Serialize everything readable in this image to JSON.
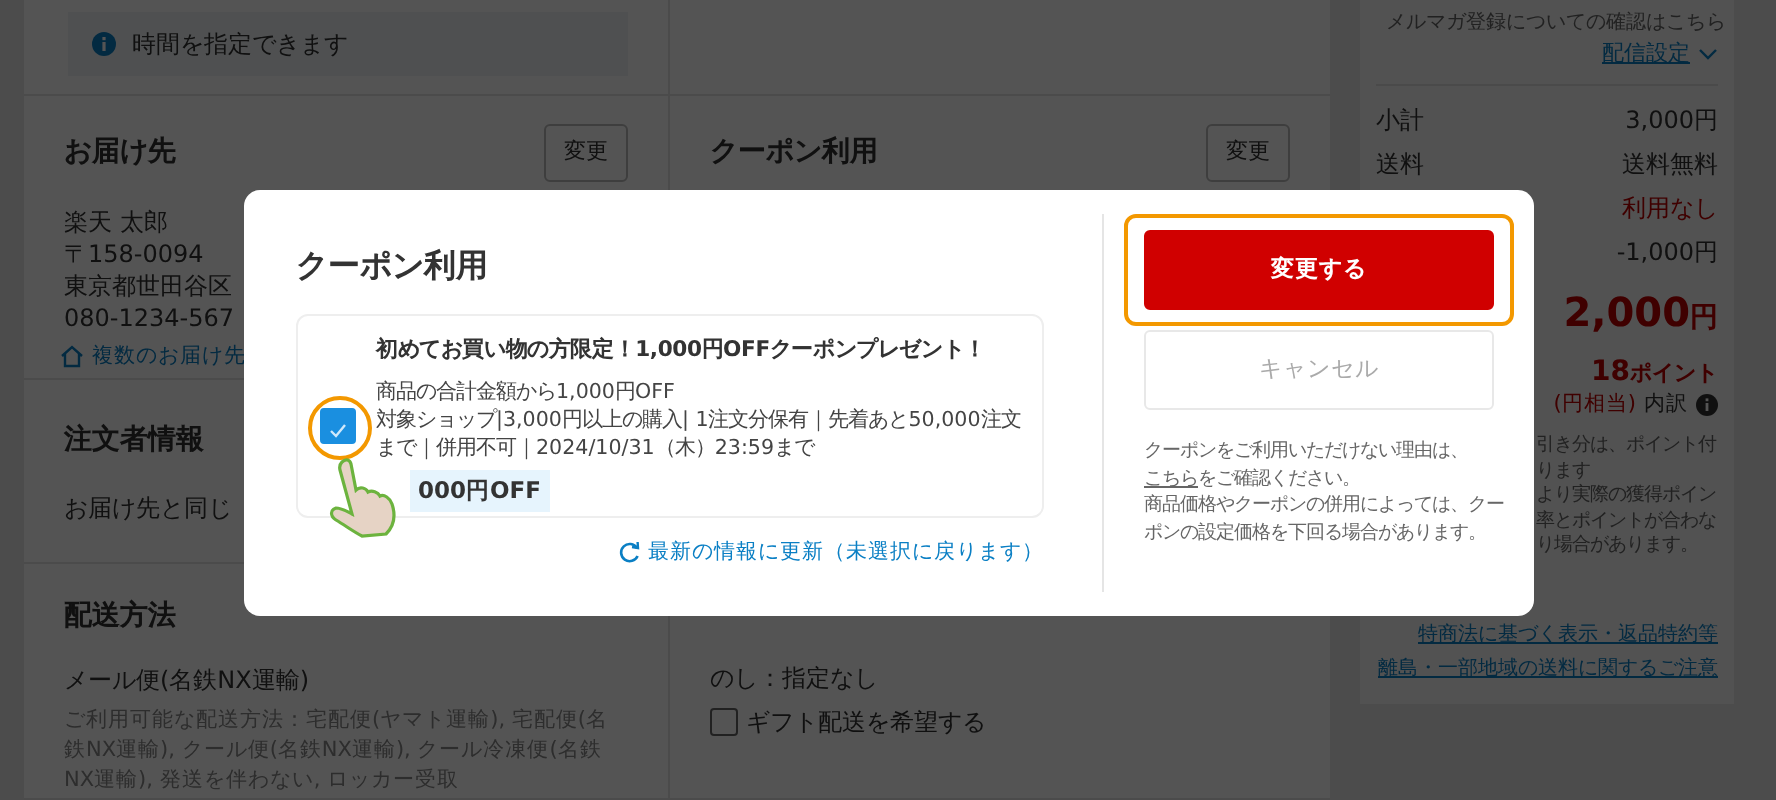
{
  "page": {
    "time_notice": "時間を指定できます",
    "shipping_address": {
      "heading": "お届け先",
      "button": "変更",
      "lines": [
        "楽天 太郎",
        "〒158-0094",
        "東京都世田谷区",
        "080-1234-567"
      ],
      "link": "複数のお届け先"
    },
    "orderer": {
      "heading": "注文者情報",
      "text": "お届け先と同じ"
    },
    "delivery_method": {
      "heading": "配送方法",
      "method": "メール便(名鉄NX運輸)",
      "available": "ご利用可能な配送方法：宅配便(ヤマト運輸), 宅配便(名鉄NX運輸), クール便(名鉄NX運輸), クール冷凍便(名鉄NX運輸), 発送を伴わない, ロッカー受取"
    },
    "coupon_section": {
      "heading": "クーポン利用",
      "button": "変更"
    },
    "gift": {
      "noshi": "のし：指定なし",
      "gift_delivery": {
        "label": "ギフト配送を希望する",
        "checked": false
      }
    },
    "summary": {
      "newsletter_note": "メルマガ登録についての確認はこちら",
      "delivery_settings_link": "配信設定",
      "rows": [
        {
          "label": "小計",
          "value": "3,000円",
          "kind": "plain"
        },
        {
          "label": "送料",
          "value": "送料無料",
          "kind": "plain"
        },
        {
          "value": "利用なし",
          "kind": "alert"
        },
        {
          "value": "-1,000円",
          "kind": "plain"
        }
      ],
      "total": "2,000",
      "total_unit": "円",
      "points": "18",
      "points_unit": "ポイント",
      "points_equiv": "(円相当)",
      "breakdown": "内訳",
      "points_note_lines": [
        "引き分は、ポイント付",
        "ります",
        "より実際の獲得ポイン",
        "率とポイントが合わな",
        "り場合があります。"
      ],
      "links": [
        "特商法に基づく表示・返品特約等",
        "離島・一部地域の送料に関するご注意"
      ]
    }
  },
  "dialog": {
    "title": "クーポン利用",
    "coupon": {
      "title": "初めてお買い物の方限定！1,000円OFFクーポンプレゼント！",
      "lines": [
        "商品の合計金額から1,000円OFF",
        "対象ショップ|3,000円以上の購入| 1注文分保有｜先着あと50,000注文まで｜併用不可｜2024/10/31（木）23:59まで"
      ],
      "discount": "000円OFF",
      "checked": true,
      "highlighted": true
    },
    "refresh_link": "最新の情報に更新（未選択に戻ります）",
    "buttons": [
      {
        "label": "変更する",
        "kind": "primary",
        "highlighted": true
      },
      {
        "label": "キャンセル",
        "kind": "secondary",
        "highlighted": false
      }
    ],
    "note": {
      "before": "クーポンをご利用いただけない理由は、",
      "link": "こちら",
      "after": "をご確認ください。",
      "extra": "商品価格やクーポンの併用によっては、クーポンの設定価格を下回る場合があります。"
    }
  }
}
